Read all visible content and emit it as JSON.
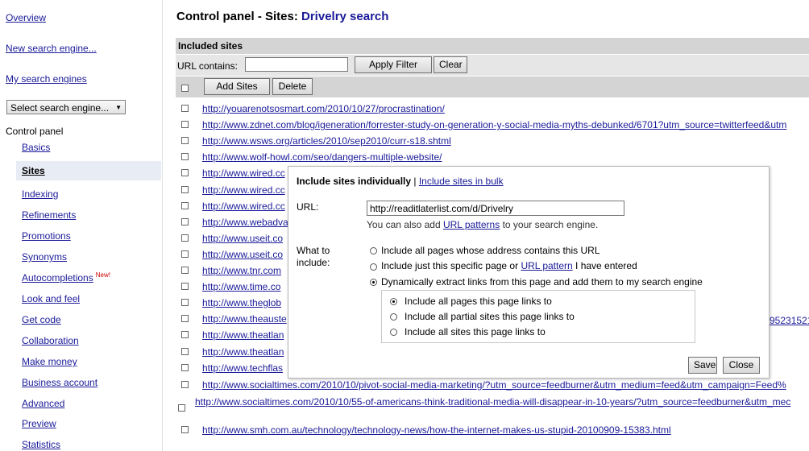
{
  "sidebar": {
    "overview": "Overview",
    "new_engine": "New search engine...",
    "my_engines": "My search engines",
    "select_engine": "Select search engine...",
    "control_panel": "Control panel",
    "items": [
      {
        "label": "Basics"
      },
      {
        "label": "Sites"
      },
      {
        "label": "Indexing"
      },
      {
        "label": "Refinements"
      },
      {
        "label": "Promotions"
      },
      {
        "label": "Synonyms"
      },
      {
        "label": "Autocompletions",
        "badge": "New!"
      },
      {
        "label": "Look and feel"
      },
      {
        "label": "Get code"
      },
      {
        "label": "Collaboration"
      },
      {
        "label": "Make money"
      },
      {
        "label": "Business account"
      },
      {
        "label": "Advanced"
      },
      {
        "label": "Preview"
      },
      {
        "label": "Statistics"
      }
    ]
  },
  "header": {
    "title_prefix": "Control panel - Sites: ",
    "engine_name": "Drivelry search"
  },
  "included": {
    "heading": "Included sites",
    "url_contains_label": "URL contains:",
    "url_contains_value": "",
    "apply_filter": "Apply Filter",
    "clear": "Clear",
    "add_sites": "Add Sites",
    "delete": "Delete",
    "rows": [
      "http://youarenotsosmart.com/2010/10/27/procrastination/",
      "http://www.zdnet.com/blog/igeneration/forrester-study-on-generation-y-social-media-myths-debunked/6701?utm_source=twitterfeed&utm",
      "http://www.wsws.org/articles/2010/sep2010/curr-s18.shtml",
      "http://www.wolf-howl.com/seo/dangers-multiple-website/",
      "http://www.wired.cc",
      "http://www.wired.cc",
      "http://www.wired.cc",
      "http://www.webadva",
      "http://www.useit.co",
      "http://www.useit.co",
      "http://www.tnr.com",
      "http://www.time.co",
      "http://www.theglob",
      "http://www.theauste",
      "http://www.theatlan",
      "http://www.theatlan",
      "http://www.techflas",
      "http://www.socialtimes.com/2010/10/pivot-social-media-marketing/?utm_source=feedburner&utm_medium=feed&utm_campaign=Feed%",
      "http://www.socialtimes.com/2010/10/55-of-americans-think-traditional-media-will-disappear-in-10-years/?utm_source=feedburner&utm_mec",
      "http://www.smh.com.au/technology/technology-news/how-the-internet-makes-us-stupid-20100909-15383.html"
    ],
    "row_tail": "95231521"
  },
  "dialog": {
    "individually": "Include sites individually",
    "separator": " | ",
    "bulk": "Include sites in bulk",
    "url_label": "URL:",
    "url_value": "http://readitlaterlist.com/d/Drivelry",
    "hint_prefix": "You can also add ",
    "hint_link": "URL patterns",
    "hint_suffix": " to your search engine.",
    "what_label_1": "What to",
    "what_label_2": "include:",
    "opt1": "Include all pages whose address contains this URL",
    "opt2_prefix": "Include just this specific page or ",
    "opt2_link": "URL pattern",
    "opt2_suffix": " I have entered",
    "opt3": "Dynamically extract links from this page and add them to my search engine",
    "sub1": "Include all pages this page links to",
    "sub2": "Include all partial sites this page links to",
    "sub3": "Include all sites this page links to",
    "save": "Save",
    "close": "Close"
  },
  "colors": {
    "link": "#1a1a99",
    "header_bg": "#d4d4d4",
    "new_badge": "#cc0000"
  }
}
